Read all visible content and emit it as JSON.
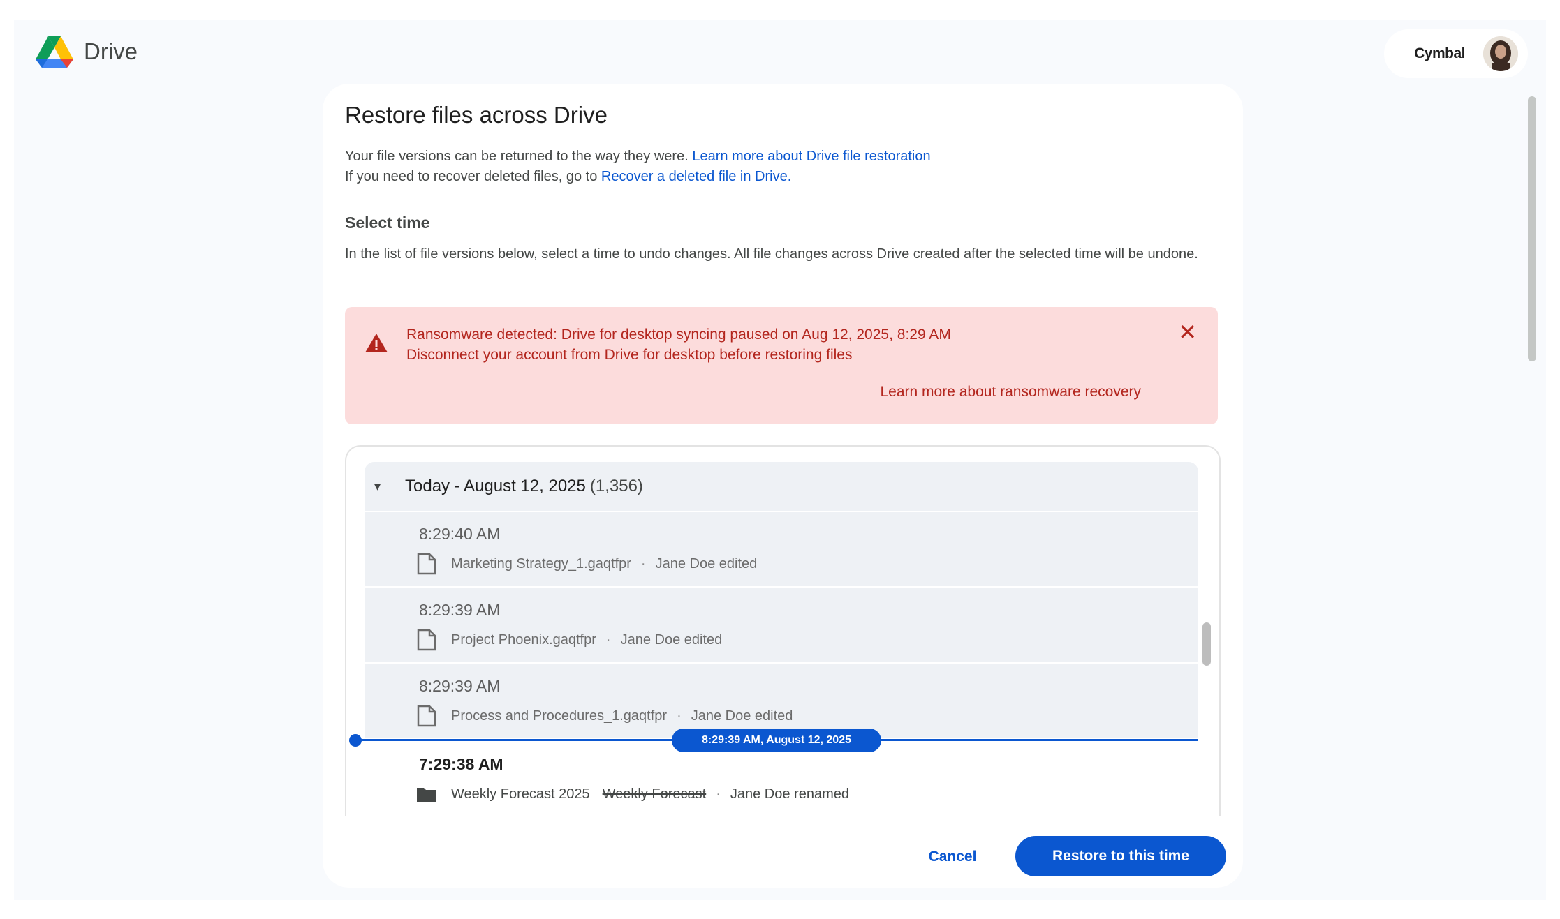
{
  "app": {
    "name": "Drive",
    "org": "Cymbal",
    "colors": {
      "accent": "#0b57d0",
      "alert_bg": "#fcdcdc",
      "alert_text": "#b3261e"
    }
  },
  "dialog": {
    "title": "Restore files across Drive",
    "intro_line1": "Your file versions can be returned to the way they were.",
    "intro_link1": "Learn more about Drive file restoration",
    "intro_line2": "If you need to recover deleted files, go to",
    "intro_link2": "Recover a deleted file in Drive.",
    "section_title": "Select time",
    "section_desc": "In the list of file versions below, select a time to undo changes. All file changes across Drive created after the selected time will be undone."
  },
  "alert": {
    "icon": "warning-triangle-icon",
    "title": "Ransomware detected: Drive for desktop syncing paused on Aug 12, 2025, 8:29 AM",
    "subtitle": "Disconnect your account from Drive for desktop before restoring files",
    "link": "Learn more about ransomware recovery",
    "close": "✕"
  },
  "versions": {
    "day_label": "Today - August 12, 2025",
    "day_count": "(1,356)",
    "rows": [
      {
        "time": "8:29:40 AM",
        "file": "Marketing Strategy_1.gaqtfpr",
        "sep": "·",
        "action": "Jane Doe edited",
        "icon": "file-icon"
      },
      {
        "time": "8:29:39 AM",
        "file": "Project Phoenix.gaqtfpr",
        "sep": "·",
        "action": "Jane Doe edited",
        "icon": "file-icon"
      },
      {
        "time": "8:29:39 AM",
        "file": "Process and Procedures_1.gaqtfpr",
        "sep": "·",
        "action": "Jane Doe edited",
        "icon": "file-icon"
      },
      {
        "time": "7:29:38 AM",
        "file": "Weekly Forecast 2025",
        "old_name": "Weekly Forecast",
        "sep": "·",
        "action": "Jane Doe renamed",
        "icon": "folder-icon"
      }
    ],
    "timeline_label": "8:29:39 AM, August 12, 2025"
  },
  "footer": {
    "cancel": "Cancel",
    "restore": "Restore to this time"
  }
}
